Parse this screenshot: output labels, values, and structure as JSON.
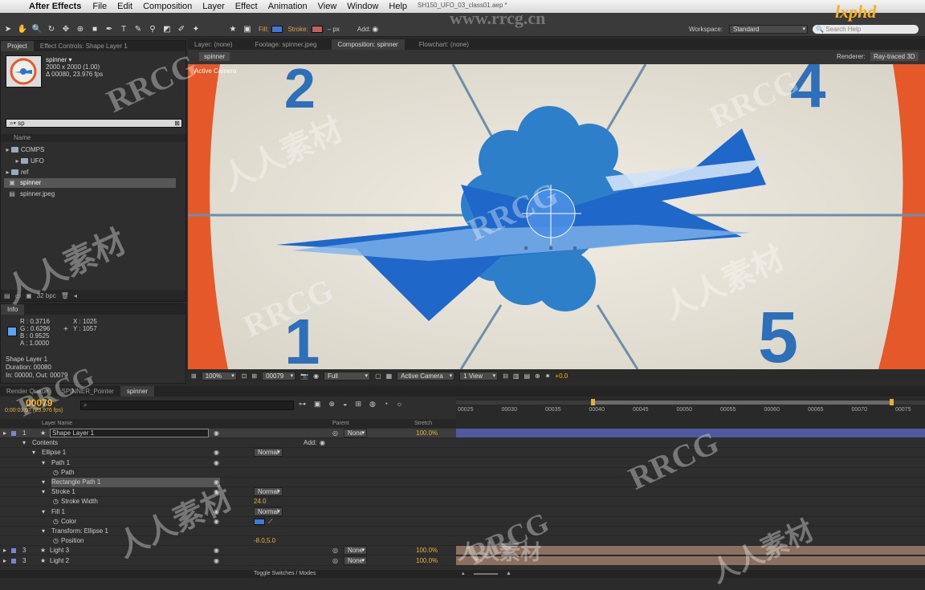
{
  "menu": {
    "app_name": "After Effects",
    "items": [
      "File",
      "Edit",
      "Composition",
      "Layer",
      "Effect",
      "Animation",
      "View",
      "Window",
      "Help"
    ],
    "document_title": "SH150_UFO_03_class01.aep *"
  },
  "toolbar": {
    "fill_label": "Fill:",
    "fill_color": "#3b7bd6",
    "stroke_label": "Stroke:",
    "stroke_color": "#c06060",
    "stroke_unit": "– px",
    "add_label": "Add:",
    "workspace_label": "Workspace:",
    "workspace_value": "Standard",
    "search_placeholder": "Search Help"
  },
  "project_panel": {
    "tabs": [
      "Project",
      "Effect Controls: Shape Layer 1"
    ],
    "comp_name": "spinner ▾",
    "comp_size": "2000 x 2000 (1.00)",
    "comp_duration": "Δ 00080, 23.976 fps",
    "search_value": "sp",
    "column_name": "Name",
    "items": [
      {
        "label": "COMPS",
        "type": "folder",
        "indent": 0
      },
      {
        "label": "UFO",
        "type": "folder",
        "indent": 1
      },
      {
        "label": "ref",
        "type": "folder",
        "indent": 0
      },
      {
        "label": "spinner",
        "type": "comp",
        "indent": 0
      },
      {
        "label": "spinner.jpeg",
        "type": "file",
        "indent": 0
      }
    ],
    "bpc": "32 bpc"
  },
  "info_panel": {
    "title": "Info",
    "r": "R : 0.3716",
    "g": "G : 0.6296",
    "b": "B : 0.9525",
    "a": "A : 1.0000",
    "x": "X : 1025",
    "y": "Y : 1057",
    "swatch_color": "#5fa1f2",
    "layer_name": "Shape Layer 1",
    "duration": "Duration: 00080",
    "inout": "In: 00000, Out: 00079"
  },
  "viewer": {
    "tabs": [
      "Layer: (none)",
      "Footage: spinner.jpeg",
      "Composition: spinner",
      "Flowchart: (none)"
    ],
    "subtab": "spinner",
    "renderer_label": "Renderer:",
    "renderer_value": "Ray-traced 3D",
    "active_camera_label": "Active Camera",
    "dial_numbers": [
      "2",
      "4",
      "1",
      "5"
    ],
    "bottom": {
      "zoom": "100%",
      "timecode": "00079",
      "resolution": "Full",
      "camera": "Active Camera",
      "views": "1 View",
      "exposure": "+0.0"
    }
  },
  "timeline": {
    "tabs": [
      "Render Queue",
      "SPINNER_Pointer",
      "spinner"
    ],
    "current_frame": "00079",
    "current_time": "0:00:03:07 (23.976 fps)",
    "col_layer_name": "Layer Name",
    "col_parent": "Parent",
    "col_stretch": "Stretch",
    "ruler": [
      "00025",
      "00030",
      "00035",
      "00040",
      "00045",
      "00050",
      "00055",
      "00060",
      "00065",
      "00070",
      "00075"
    ],
    "rows": [
      {
        "num": "1",
        "label": "Shape Layer 1",
        "indent": 0,
        "kind": "layer",
        "parent": "None",
        "stretch": "100.0%",
        "selected": true
      },
      {
        "num": "",
        "label": "Contents",
        "indent": 1,
        "kind": "group",
        "add": "Add:"
      },
      {
        "num": "",
        "label": "Ellipse 1",
        "indent": 2,
        "kind": "group",
        "mode": "Normal"
      },
      {
        "num": "",
        "label": "Path 1",
        "indent": 3,
        "kind": "group"
      },
      {
        "num": "",
        "label": "Path",
        "indent": 4,
        "kind": "prop"
      },
      {
        "num": "",
        "label": "Rectangle Path 1",
        "indent": 3,
        "kind": "group",
        "highlight": true
      },
      {
        "num": "",
        "label": "Stroke 1",
        "indent": 3,
        "kind": "group",
        "mode": "Normal"
      },
      {
        "num": "",
        "label": "Stroke Width",
        "indent": 4,
        "kind": "prop",
        "value": "24.0"
      },
      {
        "num": "",
        "label": "Fill 1",
        "indent": 3,
        "kind": "group",
        "mode": "Normal"
      },
      {
        "num": "",
        "label": "Color",
        "indent": 4,
        "kind": "prop",
        "color": "#3b7bd6"
      },
      {
        "num": "",
        "label": "Transform: Ellipse 1",
        "indent": 3,
        "kind": "group"
      },
      {
        "num": "",
        "label": "Position",
        "indent": 4,
        "kind": "prop",
        "value": "-8.0,5.0"
      },
      {
        "num": "3",
        "label": "Light 3",
        "indent": 0,
        "kind": "layer",
        "parent": "None",
        "stretch": "100.0%"
      },
      {
        "num": "3",
        "label": "Light 2",
        "indent": 0,
        "kind": "layer",
        "parent": "None",
        "stretch": "100.0%"
      }
    ],
    "toggle_label": "Toggle Switches / Modes"
  },
  "watermarks": [
    "RRCG",
    "人人素材",
    "www.rrcg.cn",
    "lxphd"
  ]
}
